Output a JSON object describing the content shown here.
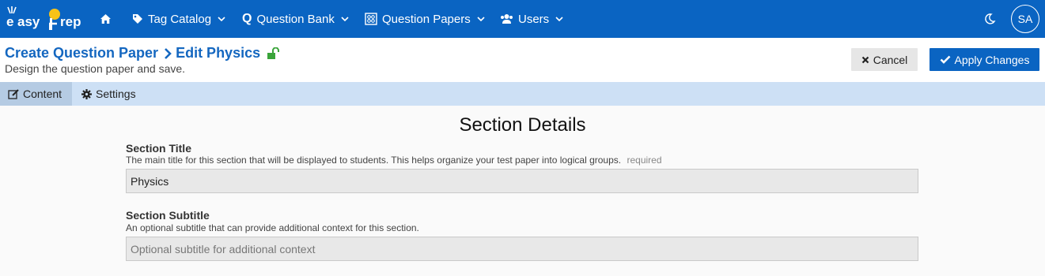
{
  "brand": {
    "word1": "asy",
    "word2": "rep",
    "e": "e",
    "p": "P"
  },
  "nav": {
    "tag_catalog": "Tag Catalog",
    "question_bank": "Question Bank",
    "question_papers": "Question Papers",
    "users": "Users"
  },
  "user": {
    "initials": "SA"
  },
  "breadcrumb": {
    "root": "Create Question Paper",
    "current": "Edit Physics"
  },
  "page": {
    "subtitle": "Design the question paper and save."
  },
  "actions": {
    "cancel": "Cancel",
    "apply": "Apply Changes"
  },
  "tabs": {
    "content": "Content",
    "settings": "Settings"
  },
  "section": {
    "heading": "Section Details",
    "title_label": "Section Title",
    "title_help": "The main title for this section that will be displayed to students. This helps organize your test paper into logical groups.",
    "title_required": "required",
    "title_value": "Physics",
    "subtitle_label": "Section Subtitle",
    "subtitle_help": "An optional subtitle that can provide additional context for this section.",
    "subtitle_value": "",
    "subtitle_placeholder": "Optional subtitle for additional context"
  },
  "colors": {
    "primary": "#0a64c2",
    "tabbar": "#cde0f5",
    "lock": "#3aa43a",
    "logo_sun": "#f7c318"
  }
}
